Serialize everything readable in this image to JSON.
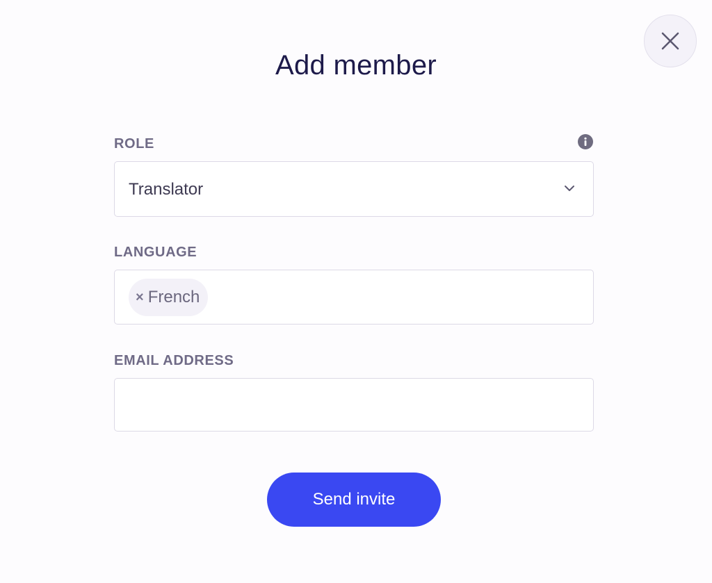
{
  "dialog": {
    "title": "Add member"
  },
  "role": {
    "label": "ROLE",
    "selected": "Translator"
  },
  "language": {
    "label": "LANGUAGE",
    "chips": [
      {
        "label": "French",
        "remove_glyph": "×"
      }
    ]
  },
  "email": {
    "label": "EMAIL ADDRESS",
    "value": "",
    "placeholder": ""
  },
  "actions": {
    "send_label": "Send invite"
  },
  "colors": {
    "accent": "#3a48f2",
    "title": "#1d1a4a",
    "label": "#6f6a86"
  },
  "icons": {
    "close": "close-icon",
    "info": "info-icon",
    "dropdown": "chevron-down-icon"
  }
}
